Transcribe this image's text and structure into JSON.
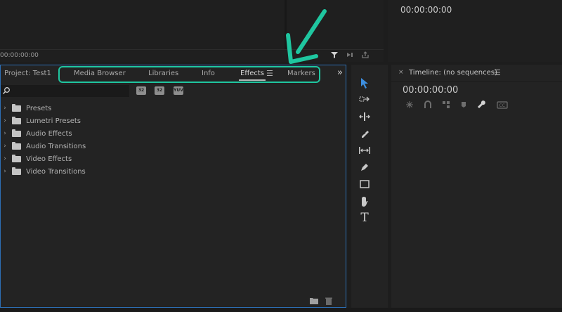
{
  "top_left": {
    "timecode": "00:00:00:00"
  },
  "top_right": {
    "timecode": "00:00:00:00"
  },
  "project_panel": {
    "title": "Project: Test1",
    "tabs": [
      {
        "label": "Media Browser"
      },
      {
        "label": "Libraries"
      },
      {
        "label": "Info"
      },
      {
        "label": "Effects",
        "active": true
      },
      {
        "label": "Markers"
      }
    ],
    "overflow": "»",
    "tree": [
      {
        "label": "Presets",
        "icon": "preset-folder-icon"
      },
      {
        "label": "Lumetri Presets",
        "icon": "preset-folder-icon"
      },
      {
        "label": "Audio Effects",
        "icon": "folder-icon"
      },
      {
        "label": "Audio Transitions",
        "icon": "folder-icon"
      },
      {
        "label": "Video Effects",
        "icon": "folder-icon"
      },
      {
        "label": "Video Transitions",
        "icon": "folder-icon"
      }
    ],
    "filters": [
      "32",
      "32",
      "YUV"
    ]
  },
  "timeline": {
    "close": "×",
    "title": "Timeline: (no sequences)",
    "timecode": "00:00:00:00"
  },
  "colors": {
    "highlight": "#1fc6a0",
    "active_border": "#2d6fb5",
    "tool_selected": "#3d8fe0"
  },
  "tools": [
    "selection-tool-icon",
    "track-select-icon",
    "ripple-edit-icon",
    "razor-icon",
    "slip-icon",
    "pen-icon",
    "rectangle-icon",
    "hand-icon",
    "type-icon"
  ]
}
